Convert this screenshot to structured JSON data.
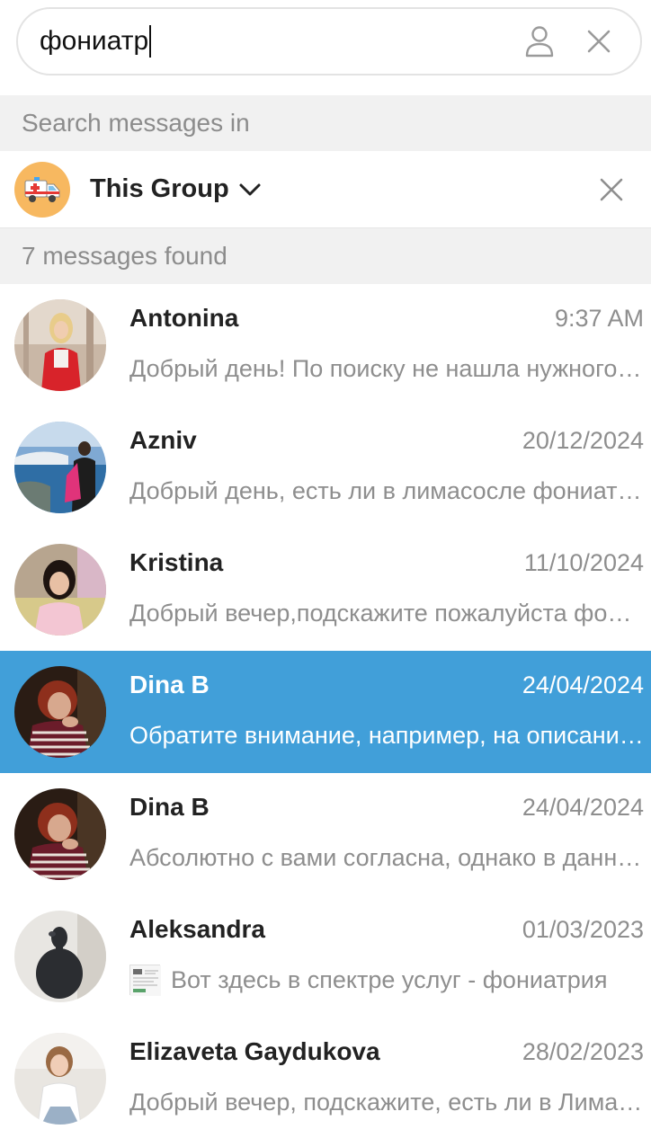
{
  "search": {
    "value": "фониатр"
  },
  "section_search_in": "Search messages in",
  "group": {
    "name": "This Group"
  },
  "section_found": "7 messages found",
  "colors": {
    "selected_bg": "#419fd9",
    "header_bg": "#f1f1f1"
  },
  "results": [
    {
      "name": "Antonina",
      "date": "9:37 AM",
      "preview": "Добрый день! По поиску не нашла нужного специалиста",
      "selected": false
    },
    {
      "name": "Azniv",
      "date": "20/12/2024",
      "preview": "Добрый день, есть ли в лимасосле фониатр?",
      "selected": false
    },
    {
      "name": "Kristina",
      "date": "11/10/2024",
      "preview": "Добрый вечер,подскажите пожалуйста фониатра",
      "selected": false
    },
    {
      "name": "Dina B",
      "date": "24/04/2024",
      "preview": "Обратите внимание, например, на описание услуг",
      "selected": true
    },
    {
      "name": "Dina B",
      "date": "24/04/2024",
      "preview": "Абсолютно с вами согласна,  однако в данном случае",
      "selected": false
    },
    {
      "name": "Aleksandra",
      "date": "01/03/2023",
      "preview": "Вот здесь в спектре услуг - фониатрия",
      "selected": false,
      "has_thumb": true
    },
    {
      "name": "Elizaveta Gaydukova",
      "date": "28/02/2023",
      "preview": "Добрый вечер, подскажите, есть ли в Лимассоле фониатр",
      "selected": false
    }
  ]
}
